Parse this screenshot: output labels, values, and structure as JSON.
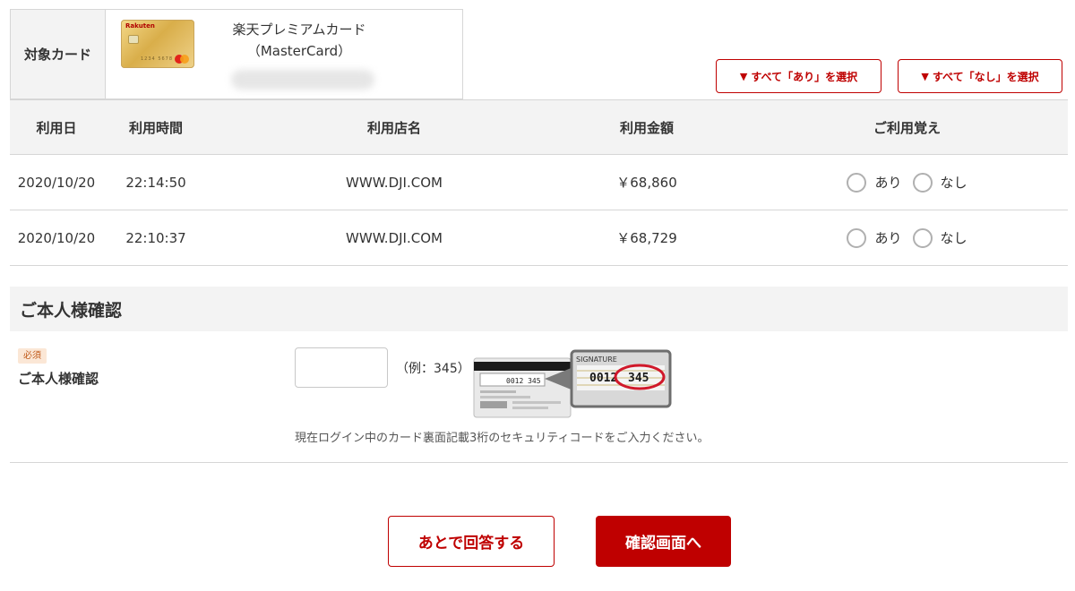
{
  "card": {
    "label": "対象カード",
    "thumb_brand": "Rakuten",
    "thumb_number": "1234 5678",
    "name_line1": "楽天プレミアムカード",
    "name_line2": "（MasterCard）"
  },
  "bulk": {
    "all_yes_label": "すべて「あり」を選択",
    "all_no_label": "すべて「なし」を選択",
    "triangle": "▼"
  },
  "table": {
    "headers": {
      "date": "利用日",
      "time": "利用時間",
      "shop": "利用店名",
      "amount": "利用金額",
      "recognize": "ご利用覚え"
    },
    "option_yes": "あり",
    "option_no": "なし",
    "rows": [
      {
        "date": "2020/10/20",
        "time": "22:14:50",
        "shop": "WWW.DJI.COM",
        "amount": "￥68,860"
      },
      {
        "date": "2020/10/20",
        "time": "22:10:37",
        "shop": "WWW.DJI.COM",
        "amount": "￥68,729"
      }
    ]
  },
  "identity": {
    "section_title": "ご本人様確認",
    "required_badge": "必須",
    "field_label": "ご本人様確認",
    "input_value": "",
    "example": "（例：345）",
    "illus_signature": "SIGNATURE",
    "illus_digits_a": "0012",
    "illus_digits_b": "345",
    "illus_small_digits": "0012 345",
    "hint": "現在ログイン中のカード裏面記載3桁のセキュリティコードをご入力ください。"
  },
  "actions": {
    "later_label": "あとで回答する",
    "confirm_label": "確認画面へ"
  },
  "colors": {
    "accent": "#bf0000",
    "header_bg": "#f3f3f3",
    "border": "#d6d6d6",
    "badge_bg": "#fbe7d6",
    "badge_text": "#c05a1a"
  }
}
